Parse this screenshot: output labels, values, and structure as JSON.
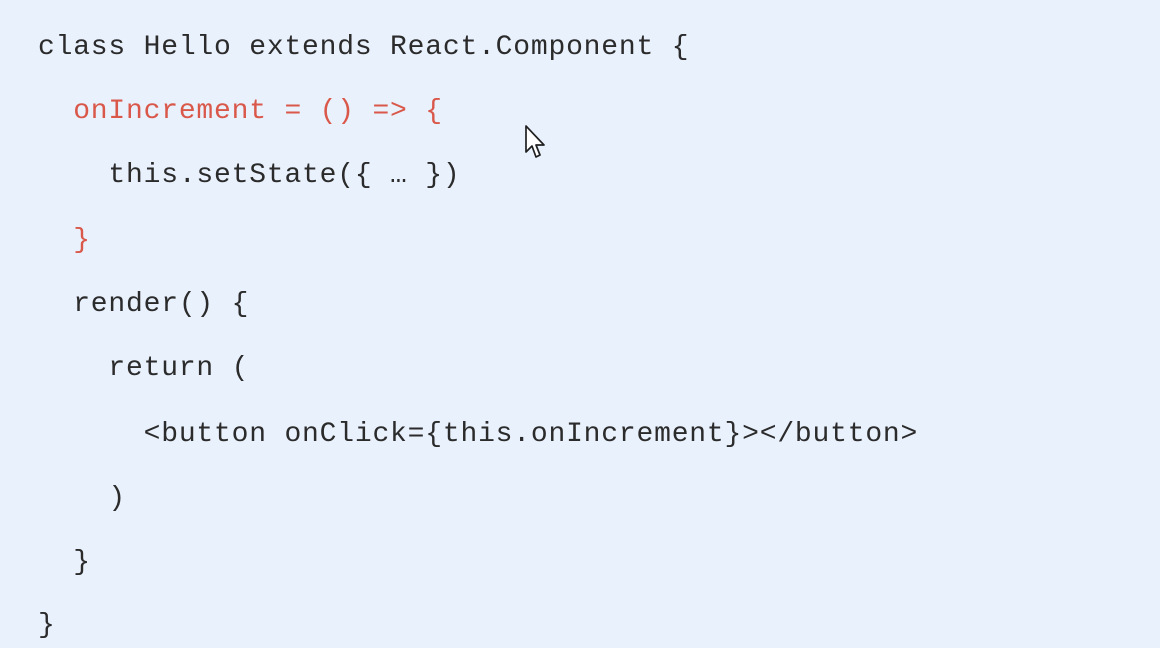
{
  "colors": {
    "background": "#e9f1fc",
    "code_default": "#2b2b2b",
    "code_highlight": "#d9584a"
  },
  "editor": {
    "lines": [
      {
        "text": "class Hello extends React.Component {",
        "highlight": false
      },
      {
        "text": "  onIncrement = () => {",
        "highlight": true
      },
      {
        "text": "    this.setState({ … })",
        "highlight": false
      },
      {
        "text": "  }",
        "highlight": true
      },
      {
        "text": "  render() {",
        "highlight": false
      },
      {
        "text": "    return (",
        "highlight": false
      },
      {
        "text": "      <button onClick={this.onIncrement}></button>",
        "highlight": false
      },
      {
        "text": "    )",
        "highlight": false
      },
      {
        "text": "  }",
        "highlight": false
      },
      {
        "text": "}",
        "highlight": false
      }
    ]
  },
  "cursor": {
    "icon": "arrow-pointer-icon"
  }
}
